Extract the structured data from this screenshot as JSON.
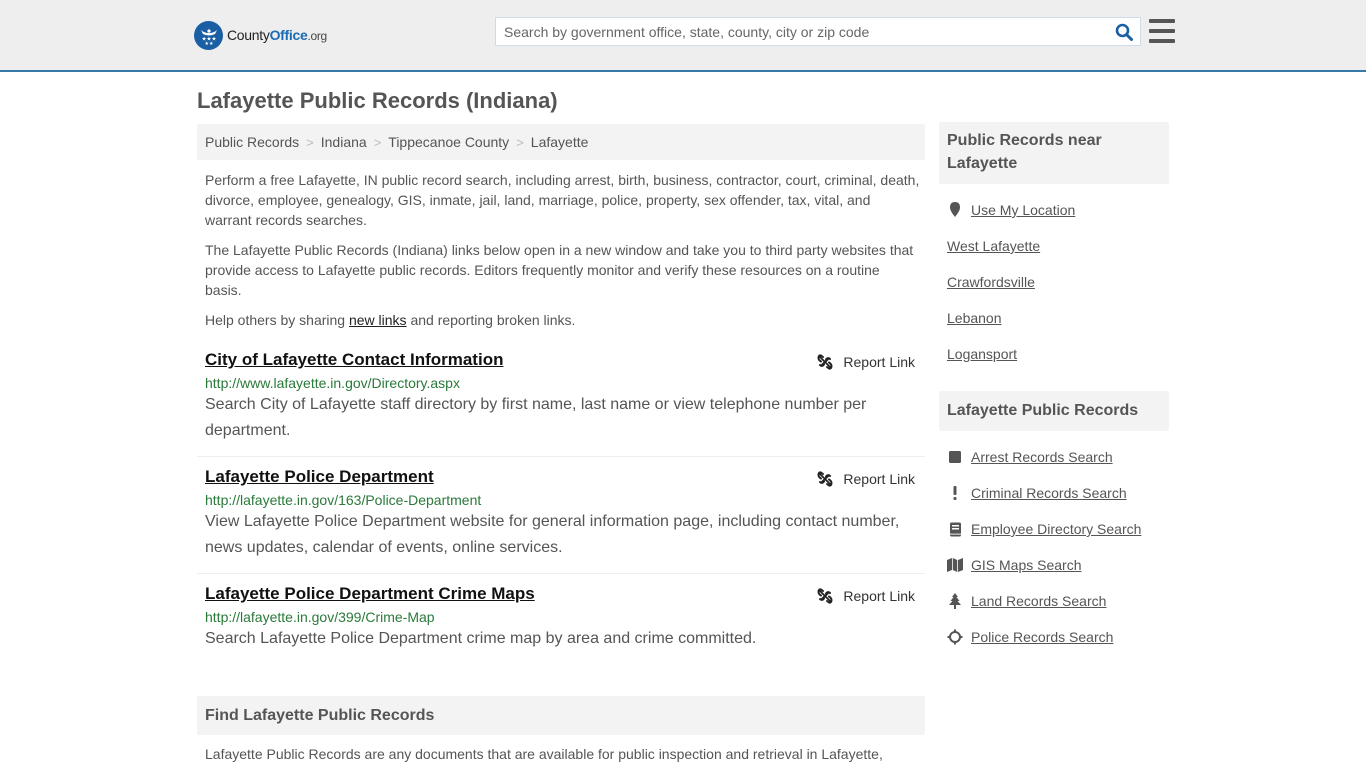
{
  "header": {
    "logo": {
      "part1": "County",
      "part2": "Office",
      "part3": ".org"
    },
    "search": {
      "placeholder": "Search by government office, state, county, city or zip code",
      "value": ""
    },
    "brand_color": "#1a5fa3",
    "border_color": "#3679a8"
  },
  "page_title": "Lafayette Public Records (Indiana)",
  "breadcrumb": [
    "Public Records",
    "Indiana",
    "Tippecanoe County",
    "Lafayette"
  ],
  "intro": {
    "p1": "Perform a free Lafayette, IN public record search, including arrest, birth, business, contractor, court, criminal, death, divorce, employee, genealogy, GIS, inmate, jail, land, marriage, police, property, sex offender, tax, vital, and warrant records searches.",
    "p2": "The Lafayette Public Records (Indiana) links below open in a new window and take you to third party websites that provide access to Lafayette public records. Editors frequently monitor and verify these resources on a routine basis.",
    "p3_before": "Help others by sharing ",
    "p3_link": "new links",
    "p3_after": " and reporting broken links."
  },
  "listings": [
    {
      "title": "City of Lafayette Contact Information",
      "url": "http://www.lafayette.in.gov/Directory.aspx",
      "description": "Search City of Lafayette staff directory by first name, last name or view telephone number per department.",
      "report_label": "Report Link"
    },
    {
      "title": "Lafayette Police Department",
      "url": "http://lafayette.in.gov/163/Police-Department",
      "description": "View Lafayette Police Department website for general information page, including contact number, news updates, calendar of events, online services.",
      "report_label": "Report Link"
    },
    {
      "title": "Lafayette Police Department Crime Maps",
      "url": "http://lafayette.in.gov/399/Crime-Map",
      "description": "Search Lafayette Police Department crime map by area and crime committed.",
      "report_label": "Report Link"
    }
  ],
  "find_section": {
    "heading": "Find Lafayette Public Records",
    "text": "Lafayette Public Records are any documents that are available for public inspection and retrieval in Lafayette,"
  },
  "sidebar": {
    "nearby": {
      "heading": "Public Records near Lafayette",
      "use_location": "Use My Location",
      "places": [
        "West Lafayette",
        "Crawfordsville",
        "Lebanon",
        "Logansport"
      ]
    },
    "records": {
      "heading": "Lafayette Public Records",
      "items": [
        {
          "label": "Arrest Records Search",
          "icon": "square-icon"
        },
        {
          "label": "Criminal Records Search",
          "icon": "exclamation-icon"
        },
        {
          "label": "Employee Directory Search",
          "icon": "book-icon"
        },
        {
          "label": "GIS Maps Search",
          "icon": "map-icon"
        },
        {
          "label": "Land Records Search",
          "icon": "tree-icon"
        },
        {
          "label": "Police Records Search",
          "icon": "crosshairs-icon"
        }
      ]
    }
  }
}
